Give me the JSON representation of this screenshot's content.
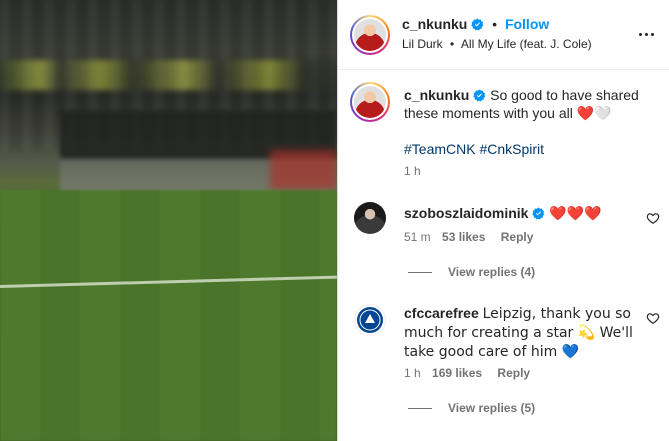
{
  "post": {
    "username": "c_nkunku",
    "follow_label": "Follow",
    "audio_artist": "Lil Durk",
    "audio_track": "All My Life (feat. J. Cole)"
  },
  "caption": {
    "username": "c_nkunku",
    "text": "So good to have shared these moments with you all",
    "emojis": "❤️🤍",
    "hashtags": "#TeamCNK #CnkSpirit",
    "time": "1 h"
  },
  "comments": [
    {
      "username": "szoboszlaidominik",
      "verified": true,
      "text": "❤️❤️❤️",
      "time": "51 m",
      "likes": "53 likes",
      "reply_label": "Reply",
      "view_replies": "View replies (4)"
    },
    {
      "username": "cfccarefree",
      "verified": false,
      "text": "Leipzig, thank you so much for creating a star 💫 We'll take good care of him 💙",
      "time": "1 h",
      "likes": "169 likes",
      "reply_label": "Reply",
      "view_replies": "View replies (5)"
    }
  ],
  "colors": {
    "accent": "#0095f6",
    "verified": "#0095f6",
    "hashtag": "#00376b",
    "secondary_text": "#737373"
  }
}
